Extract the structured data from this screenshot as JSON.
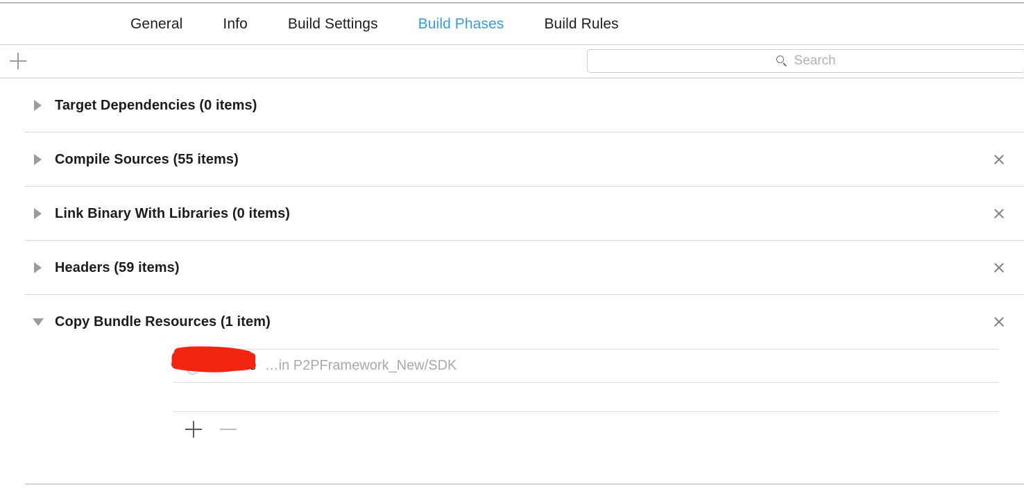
{
  "tabs": [
    {
      "label": "General",
      "active": false
    },
    {
      "label": "Info",
      "active": false
    },
    {
      "label": "Build Settings",
      "active": false
    },
    {
      "label": "Build Phases",
      "active": true
    },
    {
      "label": "Build Rules",
      "active": false
    }
  ],
  "toolbar": {
    "add_phase_icon": "plus-icon",
    "search_icon": "search-icon",
    "search_placeholder": "Search",
    "search_value": ""
  },
  "phases": [
    {
      "title": "Target Dependencies (0 items)",
      "expanded": false,
      "deletable": false
    },
    {
      "title": "Compile Sources (55 items)",
      "expanded": false,
      "deletable": true
    },
    {
      "title": "Link Binary With Libraries (0 items)",
      "expanded": false,
      "deletable": true
    },
    {
      "title": "Headers (59 items)",
      "expanded": false,
      "deletable": true
    },
    {
      "title": "Copy Bundle Resources (1 item)",
      "expanded": true,
      "deletable": true
    }
  ],
  "copy_bundle_resources": {
    "item": {
      "icon": "bundle-shield-icon",
      "name": ".bundle",
      "name_redacted": true,
      "path": "…in P2PFramework_New/SDK"
    },
    "footer": {
      "add_icon": "plus-icon",
      "remove_icon": "minus-icon"
    }
  },
  "colors": {
    "accent": "#3a9bdc",
    "text": "#1c1c1c",
    "muted": "#a9a9a9",
    "redaction": "#f42412",
    "separator": "#d2d2d2"
  }
}
